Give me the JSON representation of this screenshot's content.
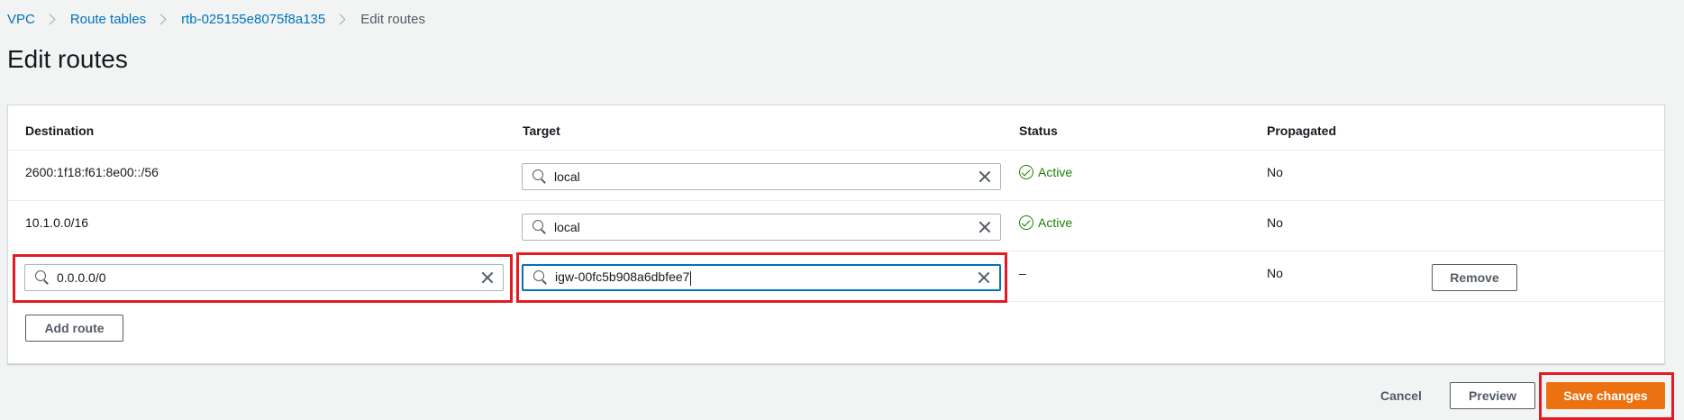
{
  "breadcrumb": {
    "items": [
      "VPC",
      "Route tables",
      "rtb-025155e8075f8a135"
    ],
    "current": "Edit routes"
  },
  "page_title": "Edit routes",
  "table": {
    "headers": {
      "destination": "Destination",
      "target": "Target",
      "status": "Status",
      "propagated": "Propagated"
    },
    "rows": [
      {
        "destination": "2600:1f18:f61:8e00::/56",
        "target": "local",
        "status": "Active",
        "propagated": "No"
      },
      {
        "destination": "10.1.0.0/16",
        "target": "local",
        "status": "Active",
        "propagated": "No"
      },
      {
        "destination": "0.0.0.0/0",
        "target": "igw-00fc5b908a6dbfee7",
        "status": "–",
        "propagated": "No",
        "remove_label": "Remove"
      }
    ]
  },
  "buttons": {
    "add_route": "Add route",
    "cancel": "Cancel",
    "preview": "Preview",
    "save": "Save changes"
  },
  "icons": {
    "status": "check-circle-icon",
    "search": "search-icon",
    "clear": "close-icon",
    "breadcrumb_separator": "chevron-right-icon"
  },
  "colors": {
    "link": "#0073bb",
    "active_status": "#1d8102",
    "primary_button": "#ec7211",
    "highlight": "#e31b23",
    "focus_border": "#0073bb"
  }
}
